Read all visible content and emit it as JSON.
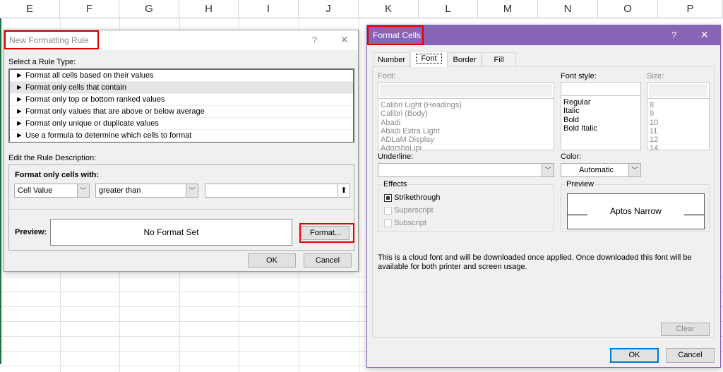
{
  "sheet": {
    "columns": [
      "E",
      "F",
      "G",
      "H",
      "I",
      "J",
      "K",
      "L",
      "M",
      "N",
      "O",
      "P"
    ]
  },
  "rule_dialog": {
    "title": "New Formatting Rule",
    "help": "?",
    "close": "✕",
    "select_label": "Select a Rule Type:",
    "rule_types": [
      "Format all cells based on their values",
      "Format only cells that contain",
      "Format only top or bottom ranked values",
      "Format only values that are above or below average",
      "Format only unique or duplicate values",
      "Use a formula to determine which cells to format"
    ],
    "selected_index": 1,
    "edit_label": "Edit the Rule Description:",
    "format_only_label": "Format only cells with:",
    "condition_type": "Cell Value",
    "operator": "greater than",
    "value": "",
    "preview_label": "Preview:",
    "preview_text": "No Format Set",
    "format_button": "Format...",
    "ok": "OK",
    "cancel": "Cancel"
  },
  "format_cells": {
    "title": "Format Cells",
    "help": "?",
    "close": "✕",
    "accent": "#8864b8",
    "tabs": [
      "Number",
      "Font",
      "Border",
      "Fill"
    ],
    "active_tab": "Font",
    "font_label": "Font:",
    "fonts": [
      "Calibri Light (Headings)",
      "Calibri (Body)",
      "Abadi",
      "Abadi Extra Light",
      "ADLaM Display",
      "AdorshoLipi"
    ],
    "font_style_label": "Font style:",
    "font_styles": [
      "Regular",
      "Italic",
      "Bold",
      "Bold Italic"
    ],
    "size_label": "Size:",
    "sizes": [
      "8",
      "9",
      "10",
      "11",
      "12",
      "14"
    ],
    "underline_label": "Underline:",
    "underline_value": "",
    "color_label": "Color:",
    "color_value": "Automatic",
    "effects_label": "Effects",
    "effects": [
      {
        "label": "Strikethrough",
        "checked": true,
        "enabled": true
      },
      {
        "label": "Superscript",
        "checked": false,
        "enabled": false
      },
      {
        "label": "Subscript",
        "checked": false,
        "enabled": false
      }
    ],
    "preview_label": "Preview",
    "preview_text": "Aptos Narrow",
    "note": "This is a cloud font and will be downloaded once applied. Once downloaded this font will be available for both printer and screen usage.",
    "clear": "Clear",
    "ok": "OK",
    "cancel": "Cancel"
  }
}
